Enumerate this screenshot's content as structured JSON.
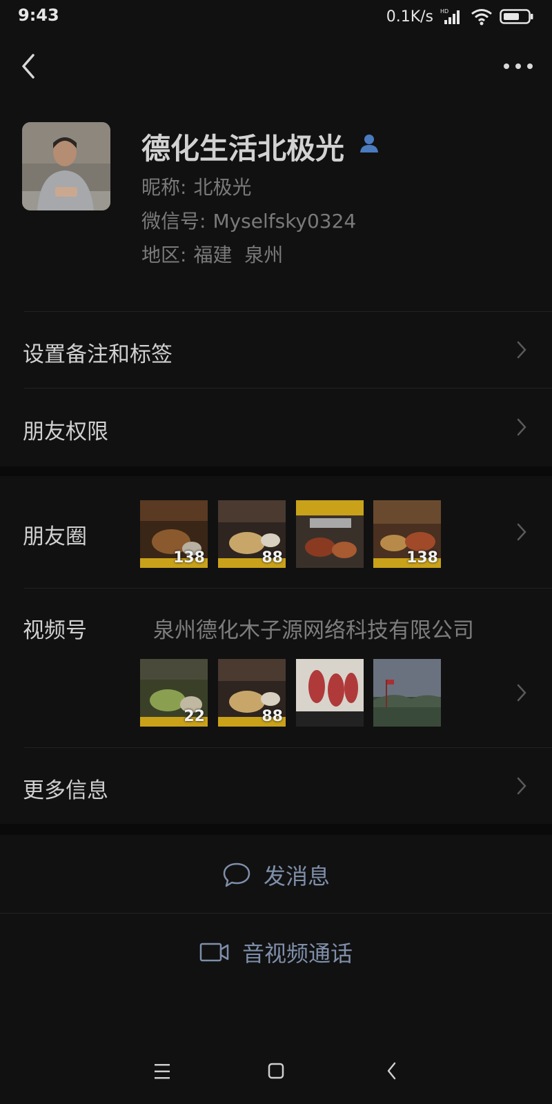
{
  "status_bar": {
    "time": "9:43",
    "speed": "0.1K/s",
    "network_badge": "HD",
    "icons": [
      "signal-icon",
      "wifi-icon",
      "battery-icon"
    ]
  },
  "profile": {
    "name": "德化生活北极光",
    "nickname_label": "昵称:",
    "nickname": "北极光",
    "wechat_id_label": "微信号:",
    "wechat_id": "Myselfsky0324",
    "region_label": "地区:",
    "region": "福建  泉州"
  },
  "menu": {
    "remarks_tags": "设置备注和标签",
    "friend_permissions": "朋友权限",
    "moments": "朋友圈",
    "channels": "视频号",
    "channel_name": "泉州德化木子源网络科技有限公司",
    "more_info": "更多信息"
  },
  "moments_thumbs": [
    {
      "price": "138"
    },
    {
      "price": "88"
    },
    {
      "price": ""
    },
    {
      "price": "138"
    }
  ],
  "channel_thumbs": [
    {
      "price": "22"
    },
    {
      "price": "88"
    },
    {
      "price": ""
    },
    {
      "price": ""
    }
  ],
  "actions": {
    "send_message": "发消息",
    "av_call": "音视频通话"
  },
  "colors": {
    "background": "#111111",
    "accent": "#7f8faa",
    "verified_icon": "#4a7bbf"
  }
}
